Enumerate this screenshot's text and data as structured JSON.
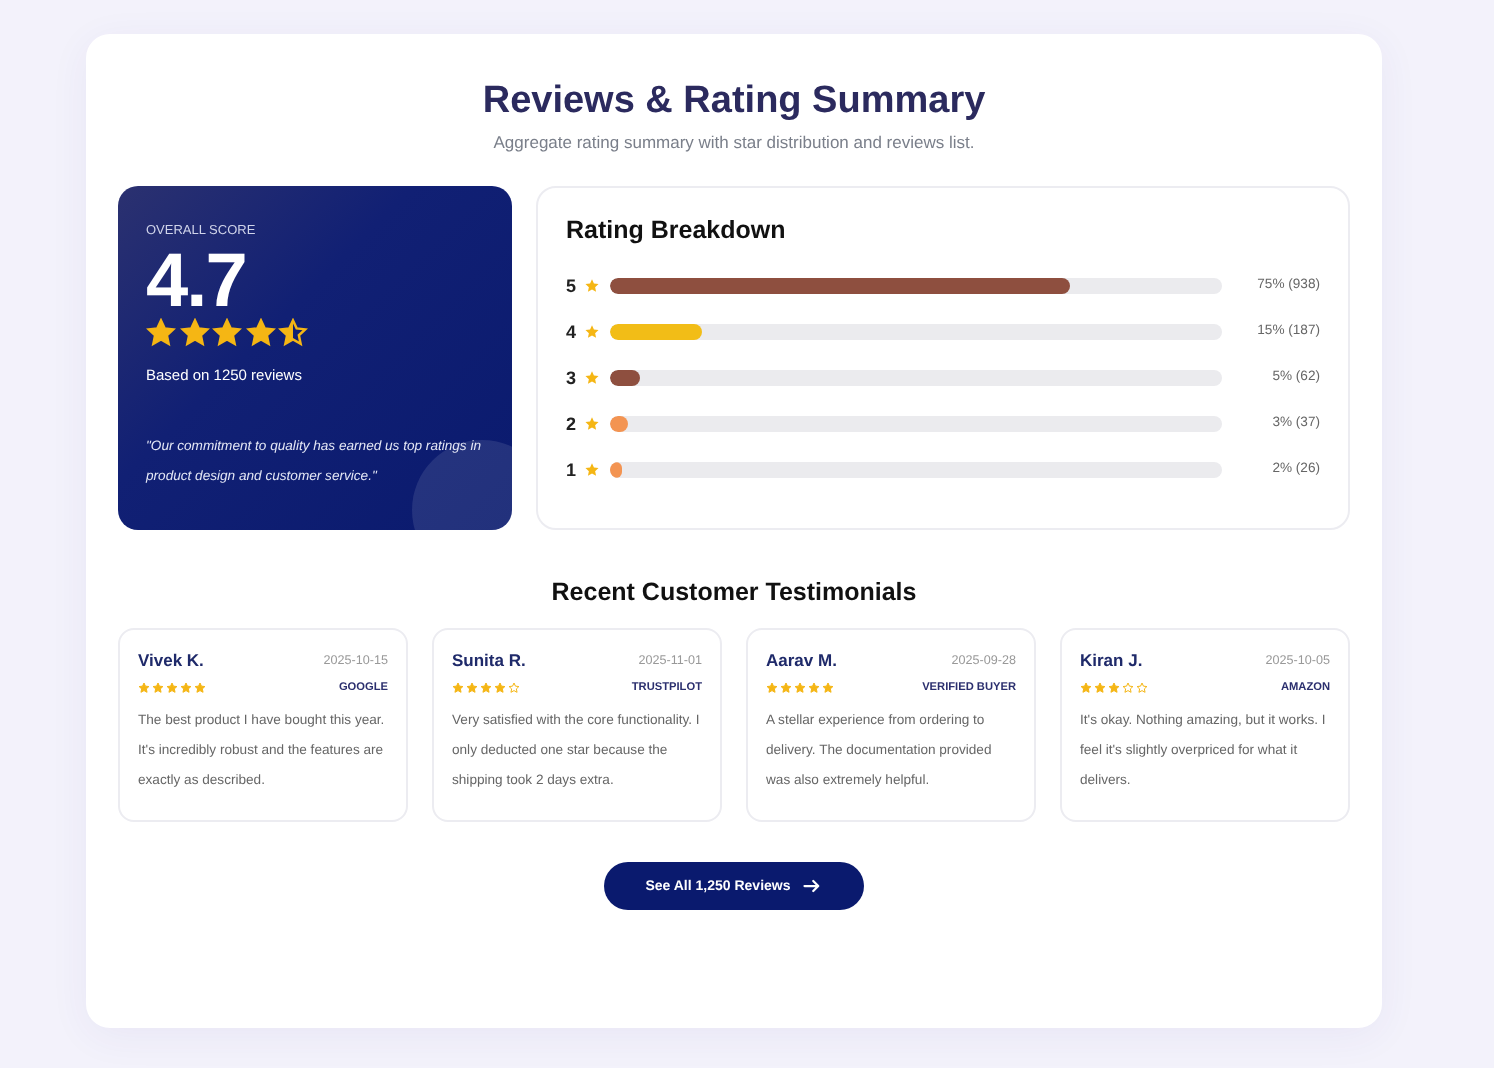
{
  "header": {
    "title": "Reviews & Rating Summary",
    "subtitle": "Aggregate rating summary with star distribution and reviews list."
  },
  "overall": {
    "label": "OVERALL SCORE",
    "score": "4.7",
    "stars": 4.5,
    "based_on": "Based on 1250 reviews",
    "quote": "\"Our commitment to quality has earned us top ratings in product design and customer service.\""
  },
  "breakdown": {
    "title": "Rating Breakdown",
    "rows": [
      {
        "star": "5",
        "level": 0.75,
        "color": "#8e4f3f",
        "reading": "75% (938)"
      },
      {
        "star": "4",
        "level": 0.15,
        "color": "#f2bd17",
        "reading": "15% (187)"
      },
      {
        "star": "3",
        "level": 0.05,
        "color": "#8e4f3f",
        "reading": "5% (62)"
      },
      {
        "star": "2",
        "level": 0.03,
        "color": "#f39452",
        "reading": "3% (37)"
      },
      {
        "star": "1",
        "level": 0.02,
        "color": "#f39452",
        "reading": "2% (26)"
      }
    ]
  },
  "testimonials": {
    "title": "Recent Customer Testimonials",
    "items": [
      {
        "name": "Vivek K.",
        "date": "2025-10-15",
        "stars": 5,
        "source": "GOOGLE",
        "text": "The best product I have bought this year. It's incredibly robust and the features are exactly as described."
      },
      {
        "name": "Sunita R.",
        "date": "2025-11-01",
        "stars": 4,
        "source": "TRUSTPILOT",
        "text": "Very satisfied with the core functionality. I only deducted one star because the shipping took 2 days extra."
      },
      {
        "name": "Aarav M.",
        "date": "2025-09-28",
        "stars": 5,
        "source": "VERIFIED BUYER",
        "text": "A stellar experience from ordering to delivery. The documentation provided was also extremely helpful."
      },
      {
        "name": "Kiran J.",
        "date": "2025-10-05",
        "stars": 3,
        "source": "AMAZON",
        "text": "It's okay. Nothing amazing, but it works. I feel it's slightly overpriced for what it delivers."
      }
    ]
  },
  "cta": {
    "label": "See All 1,250 Reviews"
  }
}
